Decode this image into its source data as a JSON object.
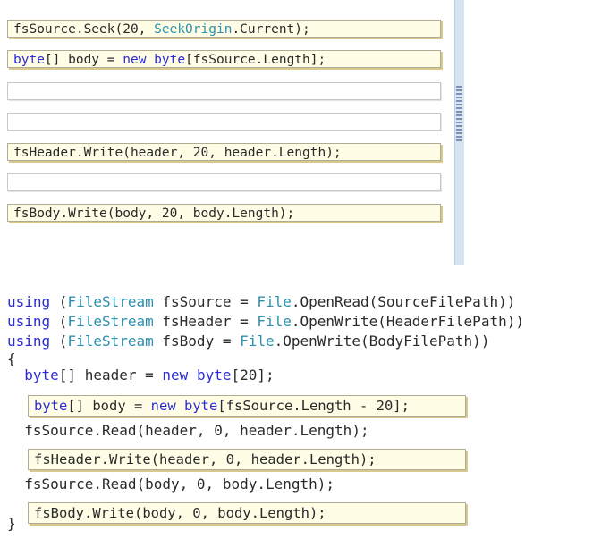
{
  "answer_slots": [
    {
      "kind": "filled",
      "tokens": [
        {
          "t": "fsSource.Seek(20, ",
          "c": "plain"
        },
        {
          "t": "SeekOrigin",
          "c": "type"
        },
        {
          "t": ".Current);",
          "c": "plain"
        }
      ]
    },
    {
      "kind": "filled",
      "tokens": [
        {
          "t": "byte",
          "c": "kw"
        },
        {
          "t": "[] body = ",
          "c": "plain"
        },
        {
          "t": "new",
          "c": "kw"
        },
        {
          "t": " ",
          "c": "plain"
        },
        {
          "t": "byte",
          "c": "kw"
        },
        {
          "t": "[fsSource.Length];",
          "c": "plain"
        }
      ]
    },
    {
      "kind": "empty",
      "tokens": []
    },
    {
      "kind": "empty",
      "tokens": []
    },
    {
      "kind": "filled",
      "tokens": [
        {
          "t": "fsHeader.Write(header, 20, header.Length);",
          "c": "plain"
        }
      ]
    },
    {
      "kind": "empty",
      "tokens": []
    },
    {
      "kind": "filled",
      "tokens": [
        {
          "t": "fsBody.Write(body, 20, body.Length);",
          "c": "plain"
        }
      ]
    }
  ],
  "code_lines": [
    {
      "kind": "line",
      "tokens": [
        {
          "t": "using",
          "c": "kw"
        },
        {
          "t": " (",
          "c": "plain"
        },
        {
          "t": "FileStream",
          "c": "type"
        },
        {
          "t": " fsSource = ",
          "c": "plain"
        },
        {
          "t": "File",
          "c": "type"
        },
        {
          "t": ".OpenRead(SourceFilePath))",
          "c": "plain"
        }
      ]
    },
    {
      "kind": "line",
      "tokens": [
        {
          "t": "using",
          "c": "kw"
        },
        {
          "t": " (",
          "c": "plain"
        },
        {
          "t": "FileStream",
          "c": "type"
        },
        {
          "t": " fsHeader = ",
          "c": "plain"
        },
        {
          "t": "File",
          "c": "type"
        },
        {
          "t": ".OpenWrite(HeaderFilePath))",
          "c": "plain"
        }
      ]
    },
    {
      "kind": "line",
      "tokens": [
        {
          "t": "using",
          "c": "kw"
        },
        {
          "t": " (",
          "c": "plain"
        },
        {
          "t": "FileStream",
          "c": "type"
        },
        {
          "t": " fsBody = ",
          "c": "plain"
        },
        {
          "t": "File",
          "c": "type"
        },
        {
          "t": ".OpenWrite(BodyFilePath))",
          "c": "plain"
        }
      ]
    },
    {
      "kind": "line",
      "tokens": [
        {
          "t": "{",
          "c": "plain"
        }
      ]
    },
    {
      "kind": "line",
      "tokens": [
        {
          "t": "  ",
          "c": "plain"
        },
        {
          "t": "byte",
          "c": "kw"
        },
        {
          "t": "[] header = ",
          "c": "plain"
        },
        {
          "t": "new",
          "c": "kw"
        },
        {
          "t": " ",
          "c": "plain"
        },
        {
          "t": "byte",
          "c": "kw"
        },
        {
          "t": "[20];",
          "c": "plain"
        }
      ]
    },
    {
      "kind": "box",
      "tokens": [
        {
          "t": "byte",
          "c": "kw"
        },
        {
          "t": "[] body = ",
          "c": "plain"
        },
        {
          "t": "new",
          "c": "kw"
        },
        {
          "t": " ",
          "c": "plain"
        },
        {
          "t": "byte",
          "c": "kw"
        },
        {
          "t": "[fsSource.Length - 20];",
          "c": "plain"
        }
      ]
    },
    {
      "kind": "line",
      "tokens": [
        {
          "t": "  fsSource.Read(header, 0, header.Length);",
          "c": "plain"
        }
      ]
    },
    {
      "kind": "box",
      "tokens": [
        {
          "t": "fsHeader.Write(header, 0, header.Length);",
          "c": "plain"
        }
      ]
    },
    {
      "kind": "line",
      "tokens": [
        {
          "t": "  fsSource.Read(body, 0, body.Length);",
          "c": "plain"
        }
      ]
    },
    {
      "kind": "box",
      "tokens": [
        {
          "t": "fsBody.Write(body, 0, body.Length);",
          "c": "plain"
        }
      ]
    },
    {
      "kind": "line",
      "tokens": [
        {
          "t": "}",
          "c": "plain"
        }
      ]
    }
  ],
  "colors": {
    "keyword": "#2b2bd6",
    "type": "#2b91af",
    "plain": "#2a2a2a",
    "slot_fill": "#fffde6",
    "slot_border": "#b0ab93"
  }
}
